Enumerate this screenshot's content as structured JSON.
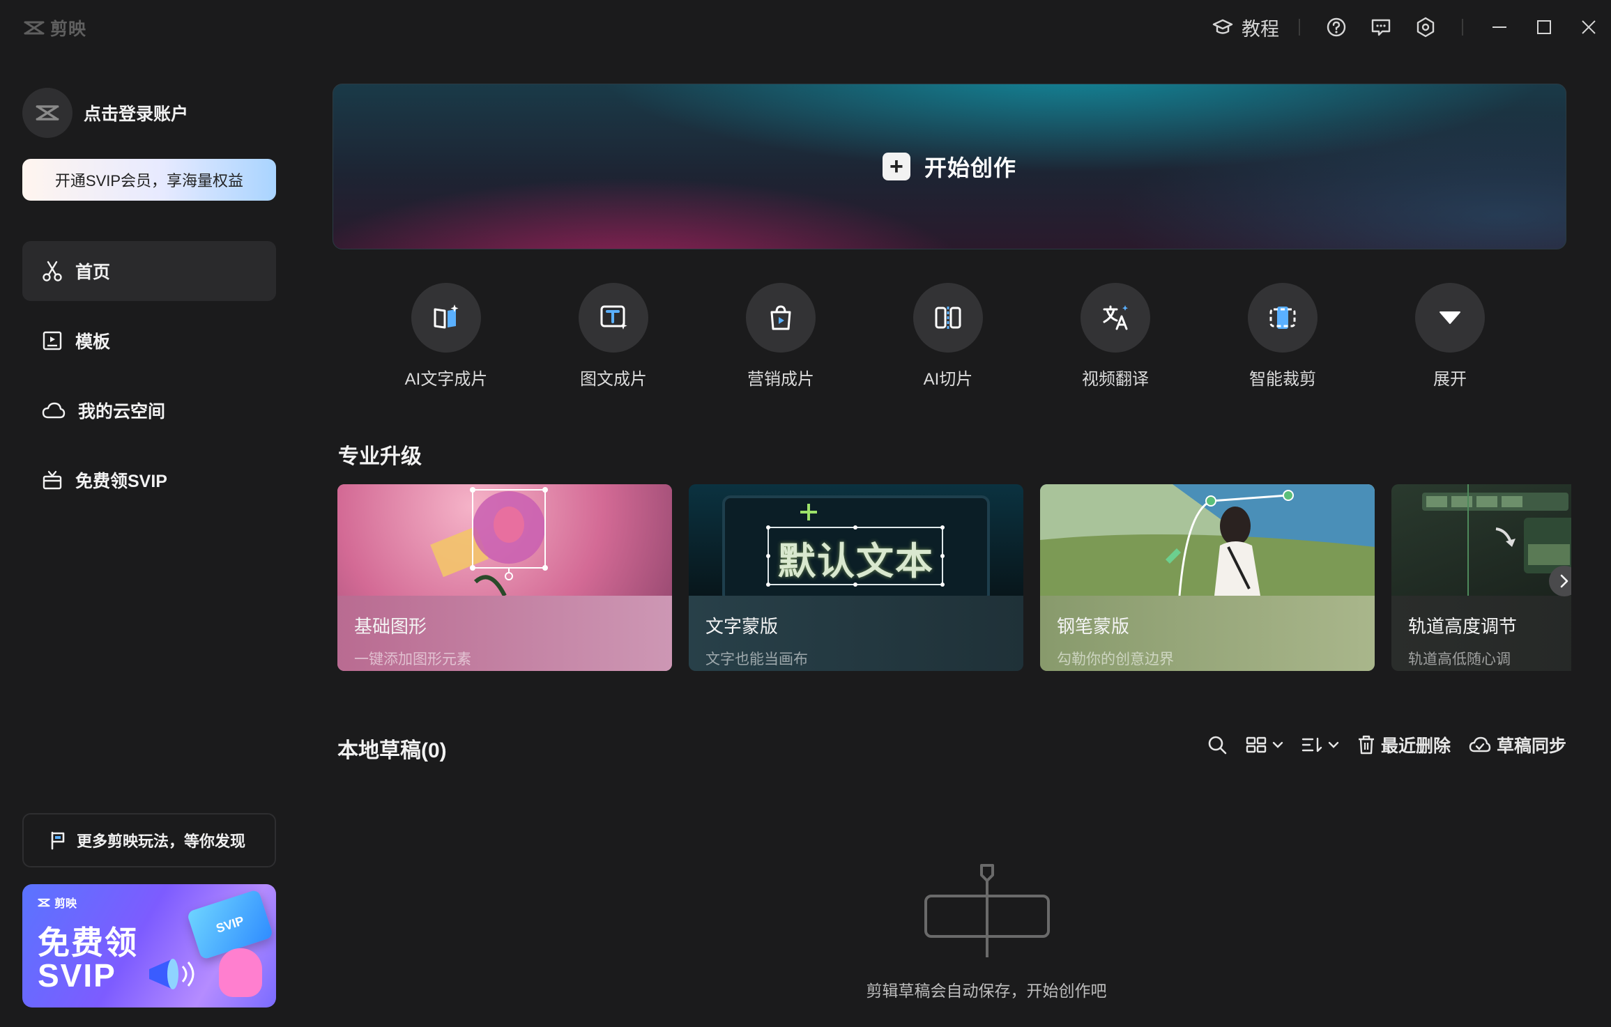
{
  "titlebar": {
    "app_name": "剪映",
    "tutorial_label": "教程"
  },
  "sidebar": {
    "login_label": "点击登录账户",
    "vip_banner": "开通SVIP会员，享海量权益",
    "nav": [
      {
        "label": "首页",
        "icon": "scissors-icon",
        "active": true
      },
      {
        "label": "模板",
        "icon": "template-icon",
        "active": false
      },
      {
        "label": "我的云空间",
        "icon": "cloud-icon",
        "active": false
      },
      {
        "label": "免费领SVIP",
        "icon": "gift-icon",
        "active": false
      }
    ],
    "more_label": "更多剪映玩法，等你发现",
    "promo": {
      "brand": "剪映",
      "title_line1": "免费领",
      "title_line2": "SVIP",
      "card_text": "SVIP"
    }
  },
  "hero": {
    "label": "开始创作"
  },
  "tools": [
    {
      "label": "AI文字成片",
      "icon": "ai-text-video-icon"
    },
    {
      "label": "图文成片",
      "icon": "image-text-video-icon"
    },
    {
      "label": "营销成片",
      "icon": "marketing-video-icon"
    },
    {
      "label": "AI切片",
      "icon": "ai-clip-icon"
    },
    {
      "label": "视频翻译",
      "icon": "translate-icon"
    },
    {
      "label": "智能裁剪",
      "icon": "smart-crop-icon"
    },
    {
      "label": "展开",
      "icon": "expand-icon"
    }
  ],
  "pro_section": {
    "title": "专业升级",
    "cards": [
      {
        "title": "基础图形",
        "subtitle": "一键添加图形元素"
      },
      {
        "title": "文字蒙版",
        "subtitle": "文字也能当画布",
        "thumb_text": "默认文本"
      },
      {
        "title": "钢笔蒙版",
        "subtitle": "勾勒你的创意边界"
      },
      {
        "title": "轨道高度调节",
        "subtitle": "轨道高低随心调"
      }
    ]
  },
  "drafts": {
    "title": "本地草稿(0)",
    "recent_delete": "最近删除",
    "sync": "草稿同步",
    "empty_text": "剪辑草稿会自动保存，开始创作吧"
  },
  "colors": {
    "background": "#1b1b1c",
    "nav_active": "#2a2a2c",
    "tool_circle": "#333335"
  }
}
